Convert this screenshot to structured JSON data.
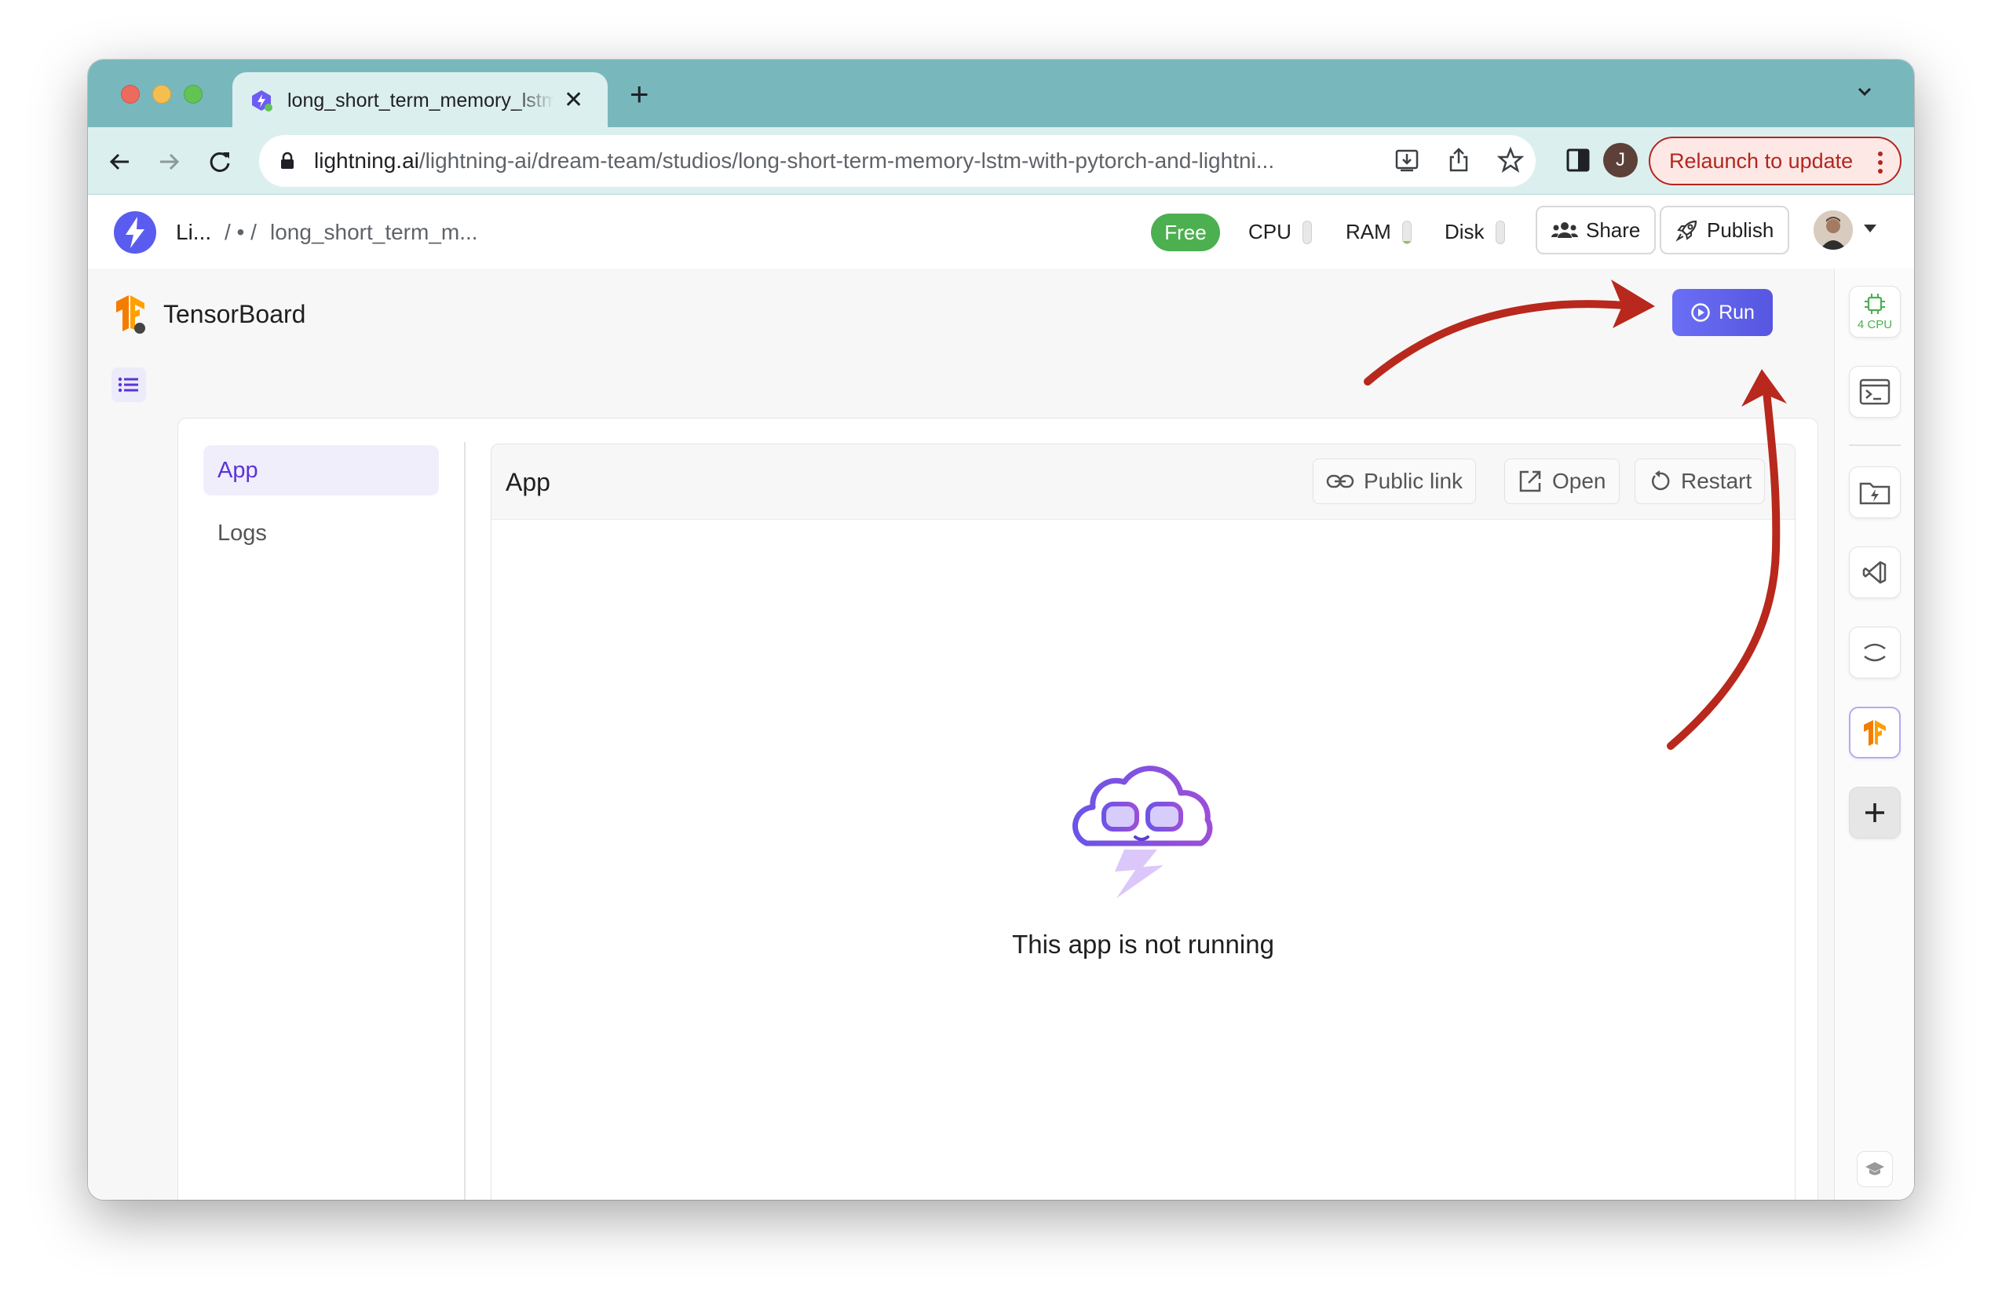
{
  "browser": {
    "tab_title": "long_short_term_memory_lstm_with_pytorch_and_lightning",
    "tab_close": "✕",
    "new_tab": "+",
    "url_host": "lightning.ai",
    "url_path": "/lightning-ai/dream-team/studios/long-short-term-memory-lstm-with-pytorch-and-lightni...",
    "profile_initial": "J",
    "relaunch_label": "Relaunch to update"
  },
  "header": {
    "org_name": "Li...",
    "crumb_sep": "/ • /",
    "studio_name": "long_short_term_m...",
    "plan_badge": "Free",
    "cpu_label": "CPU",
    "ram_label": "RAM",
    "disk_label": "Disk",
    "cpu_usage_fraction": 0.0,
    "ram_usage_fraction": 0.1,
    "disk_usage_fraction": 0.0,
    "share_label": "Share",
    "publish_label": "Publish"
  },
  "plugin": {
    "title": "TensorBoard",
    "run_label": "Run"
  },
  "nav": {
    "items": [
      {
        "label": "App",
        "active": true
      },
      {
        "label": "Logs",
        "active": false
      }
    ]
  },
  "app_panel": {
    "title": "App",
    "public_link_label": "Public link",
    "open_label": "Open",
    "restart_label": "Restart",
    "status_message": "This app is not running"
  },
  "rail": {
    "cpu_label": "4 CPU"
  },
  "colors": {
    "tab_strip": "#78b8bd",
    "toolbar": "#dcefef",
    "accent_purple": "#5b34d6",
    "run_button": "#5b5ff0",
    "free_badge": "#4caf50",
    "annotation_red": "#b8281c"
  }
}
